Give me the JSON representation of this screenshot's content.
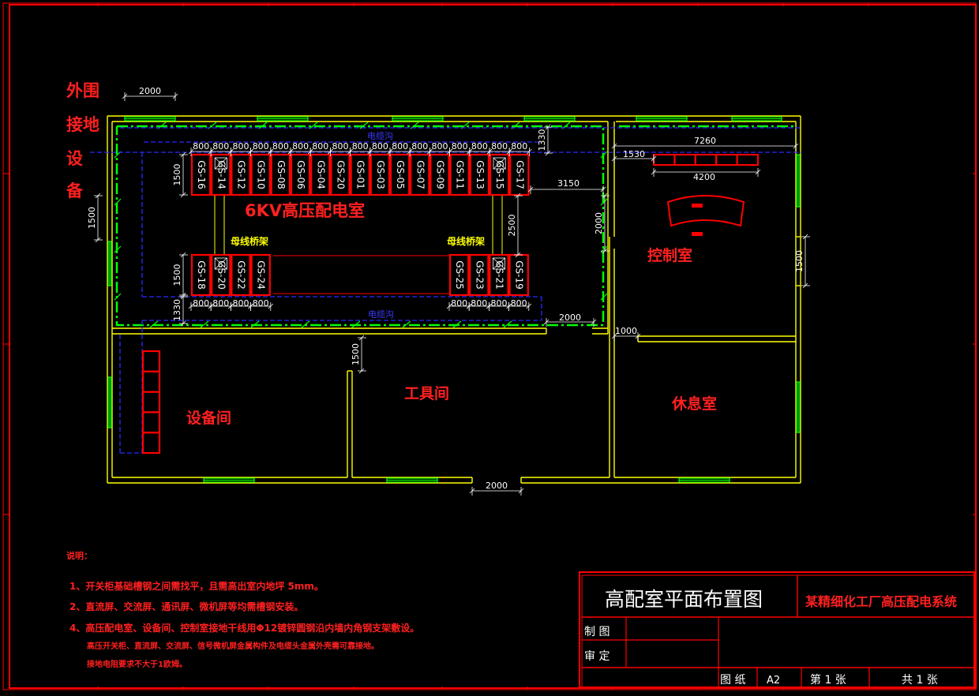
{
  "colors": {
    "background": "#000000",
    "wall": "#ffff00",
    "frame": "#ff0000",
    "cabinet": "#ff0000",
    "cabinet_label": "#ffffff",
    "room_label": "#ff2020",
    "dimension": "#ffffff",
    "cable_trench": "#2020ff",
    "ground_grid": "#00ff00",
    "window": "#00ff00"
  },
  "ground": {
    "lines": [
      "外围",
      "接地",
      "设",
      "备"
    ]
  },
  "rooms": {
    "hv_room": "6KV高压配电室",
    "control_room": "控制室",
    "equipment_room": "设备间",
    "tool_room": "工具间",
    "rest_room": "休息室"
  },
  "trench": {
    "top": "电缆沟",
    "bottom": "电缆沟"
  },
  "busbar": {
    "left": "母线桥架",
    "right": "母线桥架"
  },
  "cabinets": {
    "top_row": [
      "GS-16",
      "GS-14",
      "GS-12",
      "GS-10",
      "GS-08",
      "GS-06",
      "GS-04",
      "GS-20",
      "GS-01",
      "GS-03",
      "GS-05",
      "GS-07",
      "GS-09",
      "GS-11",
      "GS-13",
      "GS-15",
      "GS-17"
    ],
    "top_crossed": [
      1,
      15
    ],
    "bottom_left": [
      "GS-18",
      "GS-20",
      "GS-22",
      "GS-24"
    ],
    "bottom_left_crossed": [
      1
    ],
    "bottom_right": [
      "GS-25",
      "GS-23",
      "GS-21",
      "GS-19"
    ],
    "bottom_right_crossed": [
      2
    ]
  },
  "dims": {
    "cabinet_width": "800",
    "top_2000": "2000",
    "trench_1330_top": "1330",
    "cab_depth_top": "1500",
    "cab_depth_bottom": "1500",
    "left_1500": "1500",
    "gap_3150": "3150",
    "gap_2500": "2500",
    "right_2000": "2000",
    "trench_1330_bottom": "1330",
    "bottom_2000": "2000",
    "tool_1500": "1500",
    "door_2000": "2000",
    "rest_1000": "1000",
    "ctrl_7260": "7260",
    "ctrl_1530": "1530",
    "ctrl_4200": "4200",
    "ctrl_1500": "1500"
  },
  "notes": {
    "title": "说明：",
    "items": [
      "1、开关柜基础槽钢之间需找平，且需高出室内地坪 5mm。",
      "2、直流屏、交流屏、通讯屏、微机屏等均需槽钢安装。",
      "4、高压配电室、设备间、控制室接地干线用Φ12镀锌圆钢沿内墙内角钢支架敷设。",
      "高压开关柜、直流屏、交流屏、信号微机屏金属构件及电缆头金属外壳需可靠接地。",
      "接地电阻要求不大于1欧姆。"
    ]
  },
  "title_block": {
    "drawing_title": "高配室平面布置图",
    "project": "某精细化工厂高压配电系统",
    "drawn_by": "制 图",
    "reviewed_by": "审 定",
    "sheet_size_label": "图 纸",
    "sheet_size": "A2",
    "sheet_no": "第 1 张",
    "sheet_total": "共 1 张"
  }
}
